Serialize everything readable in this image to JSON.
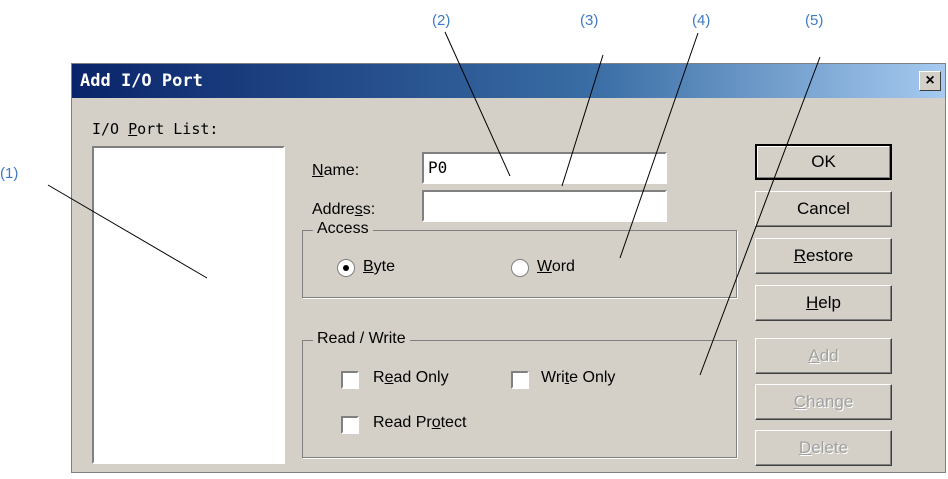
{
  "callouts": [
    "(1)",
    "(2)",
    "(3)",
    "(4)",
    "(5)"
  ],
  "dialog": {
    "title": "Add I/O Port",
    "close_glyph": "×"
  },
  "port_list": {
    "label_pre": "I/O ",
    "label_ul": "P",
    "label_post": "ort List:"
  },
  "name_field": {
    "label_ul": "N",
    "label_post": "ame:",
    "value": "P0"
  },
  "address_field": {
    "label_pre": "Addre",
    "label_ul": "s",
    "label_post": "s:",
    "value": ""
  },
  "access": {
    "legend": "Access",
    "byte": {
      "ul": "B",
      "post": "yte",
      "selected": true
    },
    "word": {
      "ul": "W",
      "post": "ord",
      "selected": false
    }
  },
  "read_write": {
    "legend": "Read / Write",
    "read_only": {
      "pre": "R",
      "ul": "e",
      "post": "ad Only",
      "checked": false
    },
    "write_only": {
      "pre": "Wri",
      "ul": "t",
      "post": "e Only",
      "checked": false
    },
    "read_protect": {
      "pre": "Read Pr",
      "ul": "o",
      "post": "tect",
      "checked": false
    }
  },
  "buttons": {
    "ok": "OK",
    "cancel": "Cancel",
    "restore": {
      "ul": "R",
      "post": "estore"
    },
    "help": {
      "ul": "H",
      "post": "elp"
    },
    "add": {
      "ul": "A",
      "post": "dd"
    },
    "change": {
      "ul": "C",
      "post": "hange"
    },
    "delete": {
      "ul": "D",
      "post": "elete"
    }
  },
  "colors": {
    "callout": "#3e7bc4",
    "titlebar_start": "#0a246a",
    "titlebar_end": "#a6caf0",
    "face": "#d4d0c8"
  }
}
